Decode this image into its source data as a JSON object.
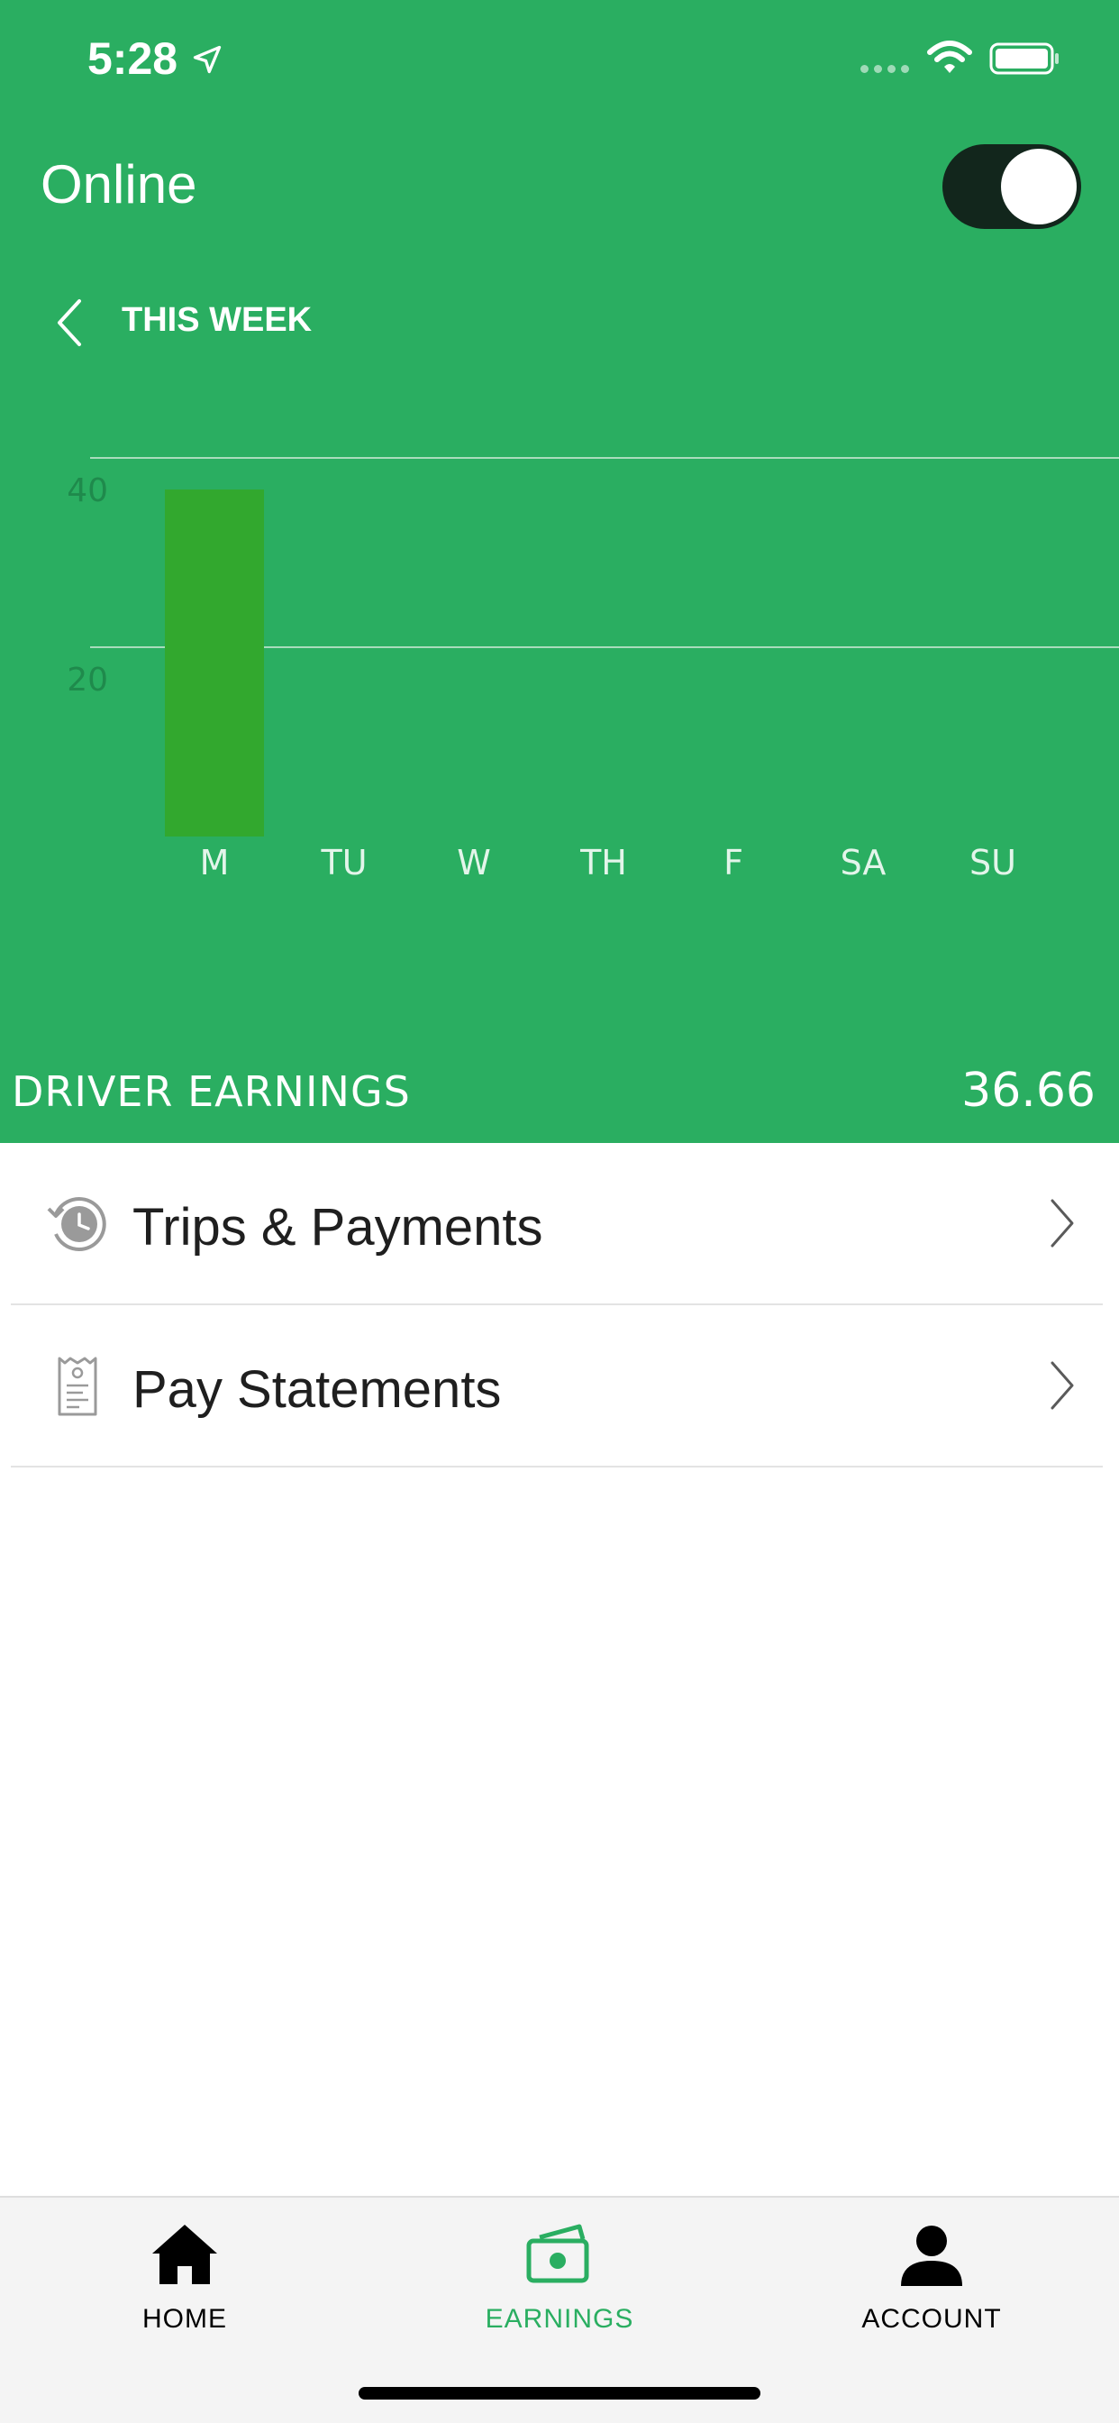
{
  "status_bar": {
    "time": "5:28"
  },
  "online": {
    "label": "Online",
    "enabled": true
  },
  "week_nav": {
    "label": "THIS WEEK"
  },
  "chart_data": {
    "type": "bar",
    "categories": [
      "M",
      "TU",
      "W",
      "TH",
      "F",
      "SA",
      "SU"
    ],
    "values": [
      36.66,
      0,
      0,
      0,
      0,
      0,
      0
    ],
    "yticks": [
      "20",
      "40"
    ],
    "grid": true,
    "colors": {
      "bar": "#32a82e",
      "grid": "#a9dcbc",
      "tick": "#1f8a4c",
      "category": "#e3f5ea"
    }
  },
  "summary": {
    "label": "DRIVER EARNINGS",
    "value": "36.66"
  },
  "list": [
    {
      "label": "Trips & Payments",
      "icon": "history-clock-icon"
    },
    {
      "label": "Pay Statements",
      "icon": "receipt-icon"
    }
  ],
  "tabs": [
    {
      "label": "HOME",
      "icon": "home-icon",
      "active": false
    },
    {
      "label": "EARNINGS",
      "icon": "cash-icon",
      "active": true
    },
    {
      "label": "ACCOUNT",
      "icon": "person-icon",
      "active": false
    }
  ],
  "colors": {
    "brand": "#2aae61",
    "toggle_track": "#12261c"
  }
}
